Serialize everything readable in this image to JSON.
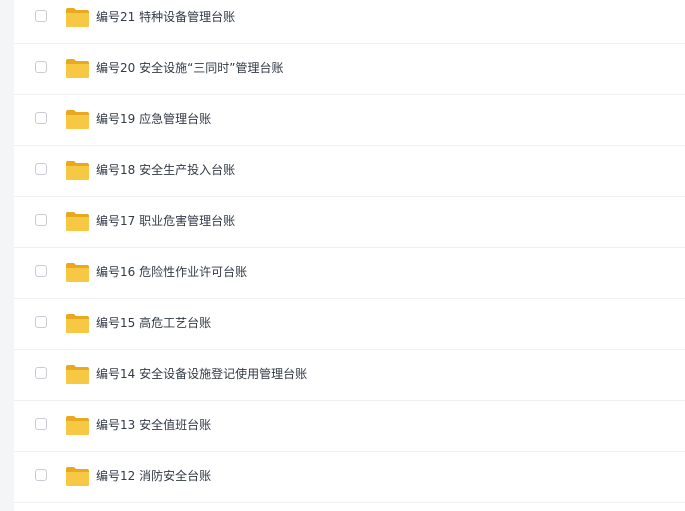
{
  "files": {
    "icon": "folder-icon",
    "folder_color": "#f7c844",
    "items": [
      {
        "name": "编号21 特种设备管理台账"
      },
      {
        "name": "编号20 安全设施“三同时”管理台账"
      },
      {
        "name": "编号19 应急管理台账"
      },
      {
        "name": "编号18 安全生产投入台账"
      },
      {
        "name": "编号17 职业危害管理台账"
      },
      {
        "name": "编号16 危险性作业许可台账"
      },
      {
        "name": "编号15 高危工艺台账"
      },
      {
        "name": "编号14 安全设备设施登记使用管理台账"
      },
      {
        "name": "编号13 安全值班台账"
      },
      {
        "name": "编号12 消防安全台账"
      }
    ]
  }
}
